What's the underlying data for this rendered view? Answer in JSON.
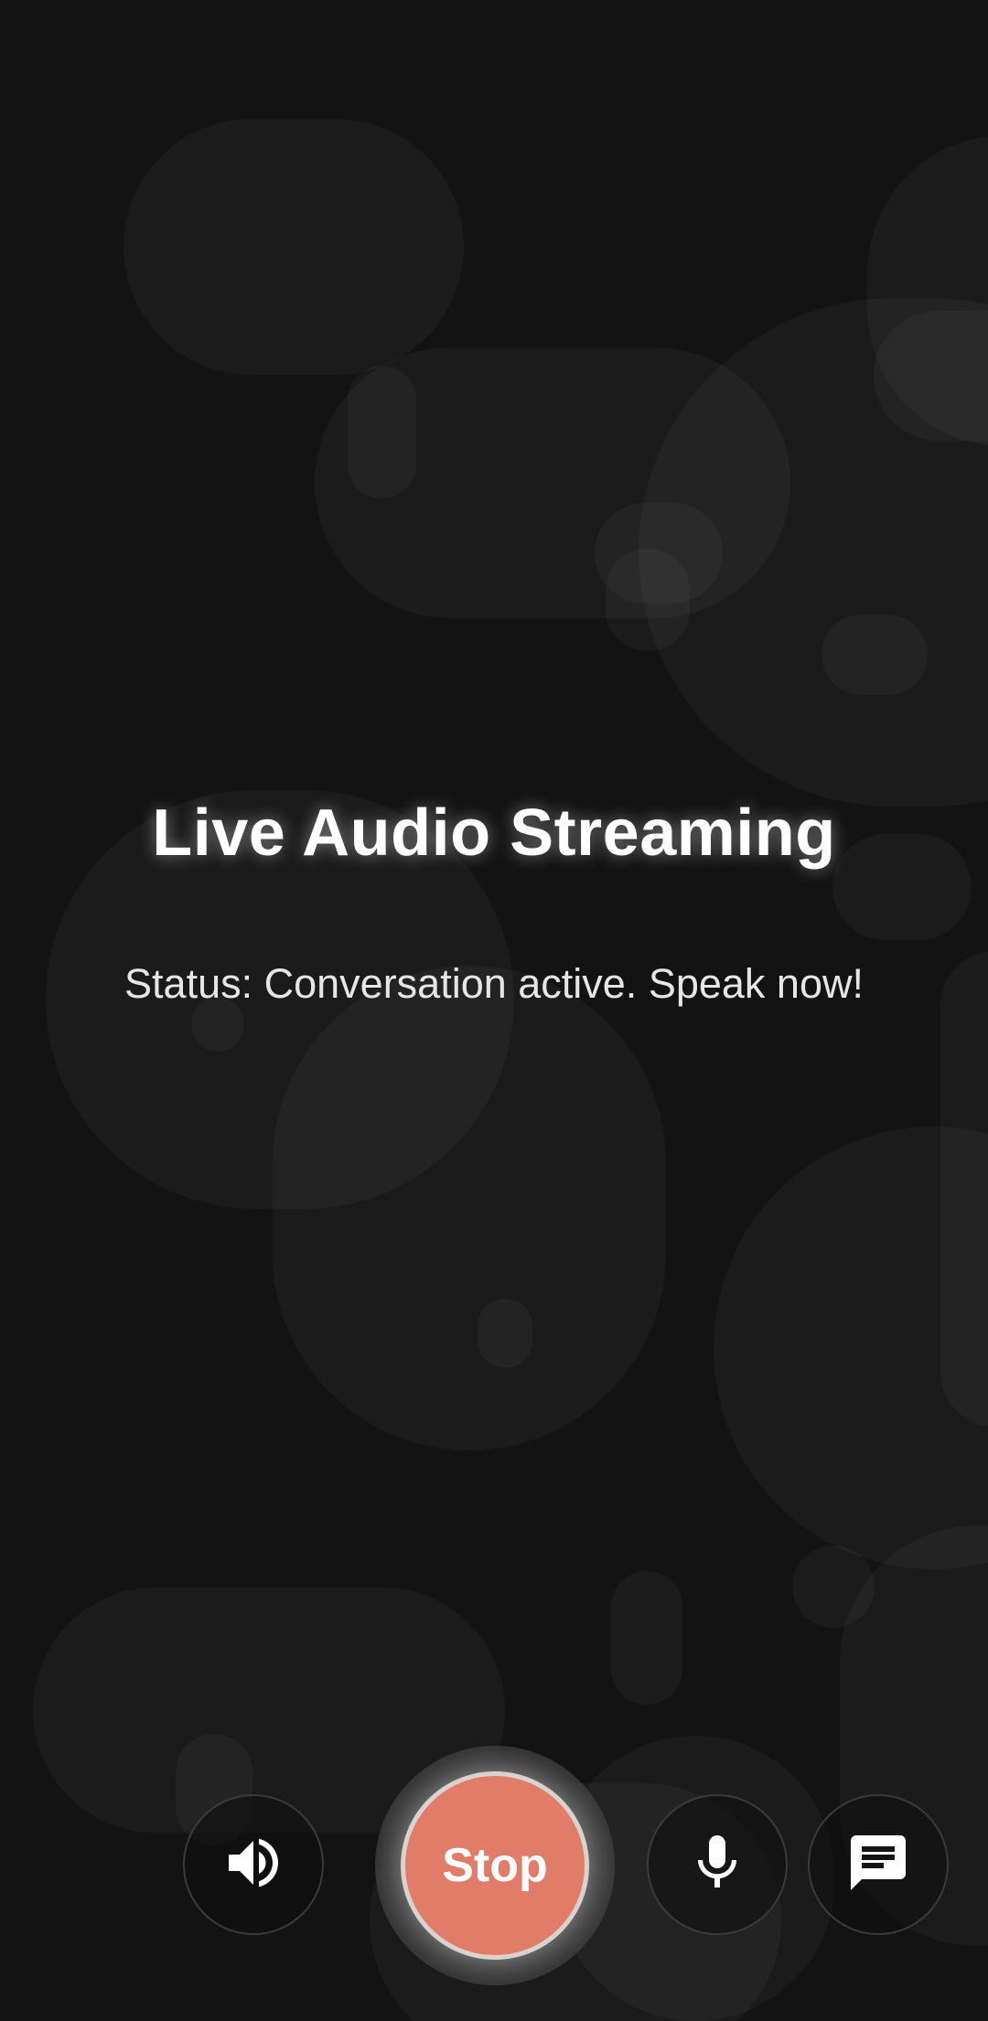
{
  "screen": {
    "title": "Live Audio Streaming",
    "status": "Status: Conversation active. Speak now!"
  },
  "controls": {
    "speaker_icon": "volume-up-icon",
    "stop_label": "Stop",
    "stop_color": "#e07c67",
    "mic_icon": "microphone-icon",
    "chat_icon": "chat-icon"
  }
}
